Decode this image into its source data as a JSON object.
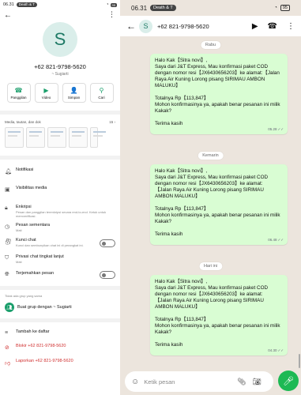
{
  "left": {
    "status": {
      "time": "06.31",
      "pill": "Death & T",
      "battery": "95"
    },
    "avatar_letter": "S",
    "phone": "+62 821-9798-5620",
    "alias": "~ Sugiarti",
    "actions": [
      {
        "label": "Panggilan",
        "icon": "☎"
      },
      {
        "label": "Video",
        "icon": "▶"
      },
      {
        "label": "Simpan",
        "icon": "👤"
      },
      {
        "label": "Cari",
        "icon": "⚲"
      }
    ],
    "media_label": "Media, tautan, dan dok",
    "media_count": "15",
    "rows": {
      "notifikasi": "Notifikasi",
      "visibilitas": "Visibilitas media",
      "enkripsi": "Enkripsi",
      "enkripsi_sub": "Pesan dan panggilan terenkripsi secara end-to-end. Ketuk untuk memverifikasi.",
      "pesan_sementara": "Pesan sementara",
      "pesan_sementara_sub": "Mati",
      "kunci_chat": "Kunci chat",
      "kunci_chat_sub": "Kunci dan sembunyikan chat ini di perangkat ini.",
      "privasi": "Privasi chat tingkat lanjut",
      "privasi_sub": "Mati",
      "terjemahkan": "Terjemahkan pesan"
    },
    "no_group": "Tidak ada grup yang sama",
    "buat_grup": "Buat grup dengan ~ Sugiarti",
    "tambah": "Tambah ke daftar",
    "blokir": "Blokir +62 821-9798-5620",
    "laporkan": "Laporkan +62 821-9798-5620"
  },
  "right": {
    "status": {
      "time": "06.31",
      "pill": "Death & T",
      "battery": "95"
    },
    "contact": "+62 821-9798-5620",
    "avatar_letter": "S",
    "dates": [
      "Rabu",
      "Kemarin",
      "Hari ini"
    ],
    "messages": [
      {
        "text": "Halo Kak【Sitra novi】,\nSaya dari J&T Express, Mau konfirmasi paket COD dengan nomor resi【JX6430656203】ke alamat:【Jalan Raya Air Kuning  Lorong pisang SIRIMAU AMBON MALUKU】",
        "total": "Totalnya Rp【113,847】\nMohon konfirmasinya ya, apakah benar pesanan ini milik Kakak?",
        "thanks": "Terima kasih",
        "time": "05.28"
      },
      {
        "text": "Halo Kak【Sitra novi】,\nSaya dari J&T Express, Mau konfirmasi paket COD dengan nomor resi【JX6430656203】ke alamat:\n【Jalan Raya Air Kuning  Lorong pisang SIRIMAU AMBON MALUKU】",
        "total": "Totalnya Rp【113,847】\nMohon konfirmasinya ya, apakah benar pesanan ini milik Kakak?",
        "thanks": "Terima kasih",
        "time": "06.48"
      },
      {
        "text": "Halo Kak【Sitra novi】,\nSaya dari J&T Express, Mau konfirmasi paket COD dengan nomor resi【JX6430656203】ke alamat:\n【Jalan Raya Air Kuning  Lorong pisang SIRIMAU AMBON MALUKU】",
        "total": "Totalnya Rp【113,847】\nMohon konfirmasinya ya, apakah benar pesanan ini milik Kakak?",
        "thanks": "Terima kasih",
        "time": "04.30"
      }
    ],
    "input_placeholder": "Ketik pesan"
  }
}
